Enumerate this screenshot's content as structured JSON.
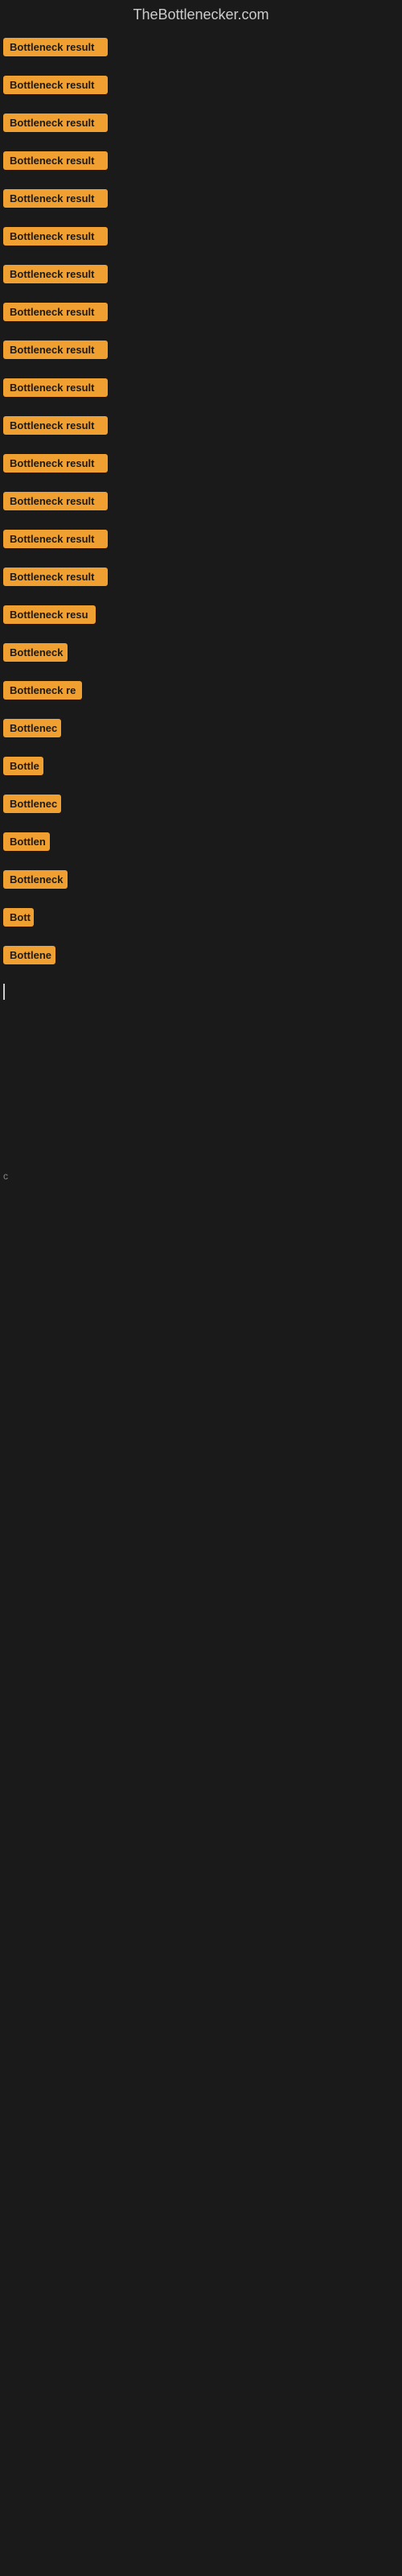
{
  "site": {
    "title": "TheBottlenecker.com"
  },
  "items": [
    {
      "id": 1,
      "label": "Bottleneck result",
      "width": 130
    },
    {
      "id": 2,
      "label": "Bottleneck result",
      "width": 130
    },
    {
      "id": 3,
      "label": "Bottleneck result",
      "width": 130
    },
    {
      "id": 4,
      "label": "Bottleneck result",
      "width": 130
    },
    {
      "id": 5,
      "label": "Bottleneck result",
      "width": 130
    },
    {
      "id": 6,
      "label": "Bottleneck result",
      "width": 130
    },
    {
      "id": 7,
      "label": "Bottleneck result",
      "width": 130
    },
    {
      "id": 8,
      "label": "Bottleneck result",
      "width": 130
    },
    {
      "id": 9,
      "label": "Bottleneck result",
      "width": 130
    },
    {
      "id": 10,
      "label": "Bottleneck result",
      "width": 130
    },
    {
      "id": 11,
      "label": "Bottleneck result",
      "width": 130
    },
    {
      "id": 12,
      "label": "Bottleneck result",
      "width": 130
    },
    {
      "id": 13,
      "label": "Bottleneck result",
      "width": 130
    },
    {
      "id": 14,
      "label": "Bottleneck result",
      "width": 130
    },
    {
      "id": 15,
      "label": "Bottleneck result",
      "width": 130
    },
    {
      "id": 16,
      "label": "Bottleneck resu",
      "width": 115
    },
    {
      "id": 17,
      "label": "Bottleneck",
      "width": 80
    },
    {
      "id": 18,
      "label": "Bottleneck re",
      "width": 98
    },
    {
      "id": 19,
      "label": "Bottlenec",
      "width": 72
    },
    {
      "id": 20,
      "label": "Bottle",
      "width": 50
    },
    {
      "id": 21,
      "label": "Bottlenec",
      "width": 72
    },
    {
      "id": 22,
      "label": "Bottlen",
      "width": 58
    },
    {
      "id": 23,
      "label": "Bottleneck",
      "width": 80
    },
    {
      "id": 24,
      "label": "Bott",
      "width": 38
    },
    {
      "id": 25,
      "label": "Bottlene",
      "width": 65
    }
  ],
  "cursor": true,
  "small_char": "c"
}
